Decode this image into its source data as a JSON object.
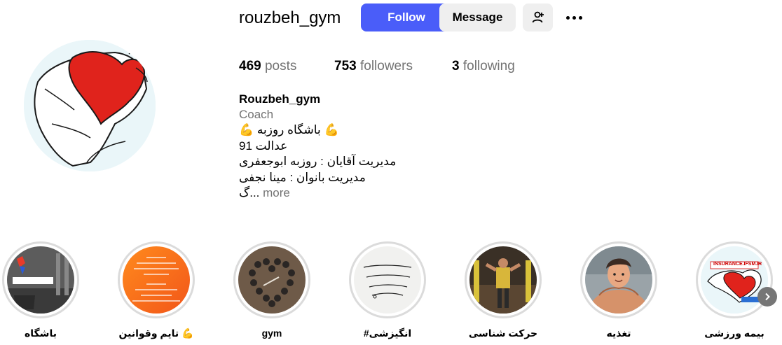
{
  "profile": {
    "username": "rouzbeh_gym",
    "follow_label": "Follow",
    "message_label": "Message",
    "stats": {
      "posts_count": "469",
      "posts_label": "posts",
      "followers_count": "753",
      "followers_label": "followers",
      "following_count": "3",
      "following_label": "following"
    },
    "bio": {
      "name": "Rouzbeh_gym",
      "category": "Coach",
      "lines": [
        "💪 باشگاه روزبه 💪",
        "عدالت 91",
        "مدیریت آقایان : روزبه ابوجعفری",
        "مدیریت بانوان : مینا نجفی"
      ],
      "truncated": "گ...",
      "more_label": "more"
    }
  },
  "highlights": [
    {
      "label": "بیمه ورزشی",
      "image_text": "INSURANCE.IFSM.IR"
    },
    {
      "label": "تغذیه"
    },
    {
      "label": "حرکت شناسی"
    },
    {
      "label": "#انگیزشی"
    },
    {
      "label": "gym"
    },
    {
      "label": "تایم وقوانین 💪"
    },
    {
      "label": "باشگاه"
    }
  ],
  "colors": {
    "follow_button": "#4a5df9",
    "secondary_button": "#efefef",
    "muted_text": "#737373",
    "highlight_ring": "#dbdbdb",
    "heart_red": "#e0231c"
  }
}
